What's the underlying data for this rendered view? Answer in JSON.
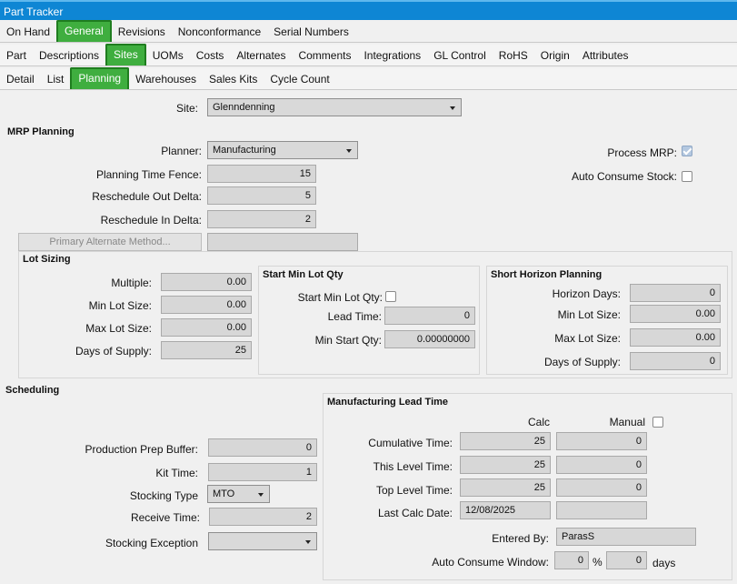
{
  "title": "Part Tracker",
  "tabs1": [
    "On Hand",
    "General",
    "Revisions",
    "Nonconformance",
    "Serial Numbers"
  ],
  "tabs2": [
    "Part",
    "Descriptions",
    "Sites",
    "UOMs",
    "Costs",
    "Alternates",
    "Comments",
    "Integrations",
    "GL Control",
    "RoHS",
    "Origin",
    "Attributes"
  ],
  "tabs3": [
    "Detail",
    "List",
    "Planning",
    "Warehouses",
    "Sales Kits",
    "Cycle Count"
  ],
  "site": {
    "label": "Site:",
    "value": "Glenndenning"
  },
  "mrp": {
    "title": "MRP Planning",
    "planner_label": "Planner:",
    "planner_value": "Manufacturing",
    "fence_label": "Planning Time Fence:",
    "fence_value": "15",
    "out_label": "Reschedule Out Delta:",
    "out_value": "5",
    "in_label": "Reschedule In Delta:",
    "in_value": "2",
    "primary_alt_button": "Primary Alternate Method...",
    "process_mrp_label": "Process MRP:",
    "auto_consume_label": "Auto Consume Stock:"
  },
  "lot": {
    "title": "Lot Sizing",
    "multiple_label": "Multiple:",
    "multiple_value": "0.00",
    "min_label": "Min Lot Size:",
    "min_value": "0.00",
    "max_label": "Max Lot Size:",
    "max_value": "0.00",
    "days_label": "Days of Supply:",
    "days_value": "25"
  },
  "startmin": {
    "title": "Start Min Lot Qty",
    "check_label": "Start Min Lot Qty:",
    "lead_label": "Lead Time:",
    "lead_value": "0",
    "minstart_label": "Min Start Qty:",
    "minstart_value": "0.00000000"
  },
  "short": {
    "title": "Short Horizon Planning",
    "horizon_label": "Horizon Days:",
    "horizon_value": "0",
    "min_label": "Min Lot Size:",
    "min_value": "0.00",
    "max_label": "Max Lot Size:",
    "max_value": "0.00",
    "days_label": "Days of Supply:",
    "days_value": "0"
  },
  "sched": {
    "title": "Scheduling",
    "prep_label": "Production Prep Buffer:",
    "prep_value": "0",
    "kit_label": "Kit Time:",
    "kit_value": "1",
    "stock_label": "Stocking Type",
    "stock_value": "MTO",
    "receive_label": "Receive Time:",
    "receive_value": "2",
    "exception_label": "Stocking Exception",
    "exception_value": ""
  },
  "mlt": {
    "title": "Manufacturing Lead Time",
    "calc_header": "Calc",
    "manual_header": "Manual",
    "cum_label": "Cumulative Time:",
    "cum_calc": "25",
    "cum_manual": "0",
    "this_label": "This Level Time:",
    "this_calc": "25",
    "this_manual": "0",
    "top_label": "Top Level Time:",
    "top_calc": "25",
    "top_manual": "0",
    "date_label": "Last Calc Date:",
    "date_value": "12/08/2025",
    "date_manual": "",
    "entered_label": "Entered By:",
    "entered_value": "ParasS",
    "window_label": "Auto Consume Window:",
    "window_value": "0",
    "pct": "%",
    "window_days": "0",
    "days": "days"
  }
}
